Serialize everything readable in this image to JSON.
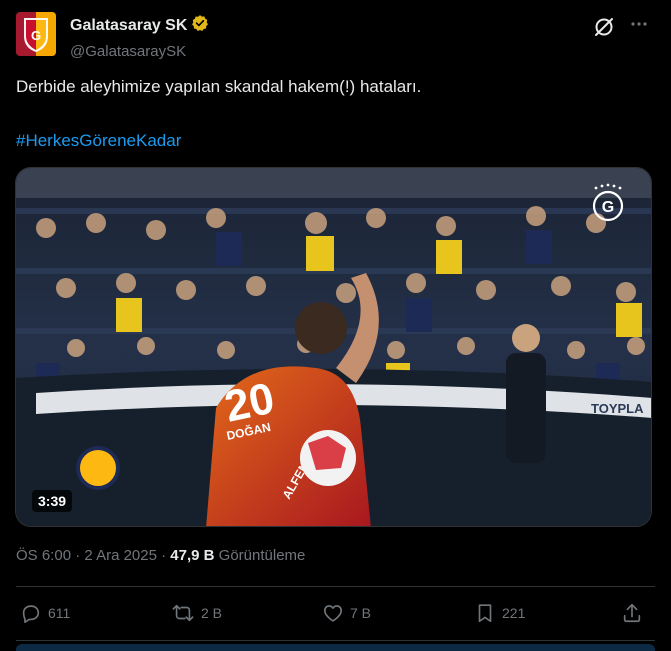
{
  "account": {
    "display_name": "Galatasaray SK",
    "handle": "@GalatasaraySK"
  },
  "tweet": {
    "text": "Derbide aleyhimize yapılan skandal hakem(!) hataları.",
    "hashtag": "#HerkesGöreneKadar"
  },
  "media": {
    "duration": "3:39",
    "player_number": "20",
    "player_name": "DOĞAN",
    "sponsor": "ALFEMO",
    "board_text": "TOYPLA"
  },
  "meta": {
    "time": "ÖS 6:00",
    "separator": "·",
    "date": "2 Ara 2025",
    "separator2": "·",
    "views_count": "47,9 B",
    "views_label": "Görüntüleme"
  },
  "actions": {
    "replies": "611",
    "reposts": "2 B",
    "likes": "7 B",
    "bookmarks": "221"
  },
  "colors": {
    "accent": "#1d9bf0",
    "muted": "#71767b",
    "gold_verified": "#e2b719",
    "gs_red": "#c8102e",
    "gs_yellow": "#fdb912"
  }
}
